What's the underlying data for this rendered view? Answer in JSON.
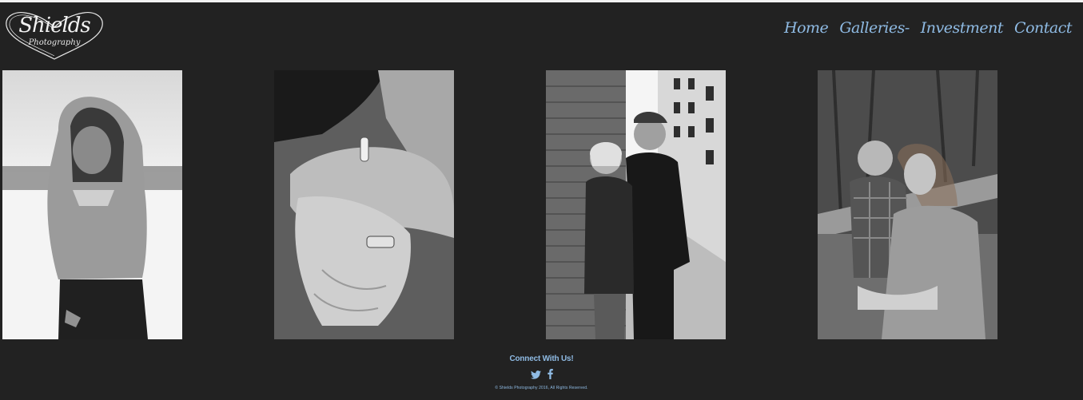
{
  "brand": {
    "name": "Shields",
    "tagline": "Photography"
  },
  "nav": {
    "items": [
      {
        "label": "Home"
      },
      {
        "label": "Galleries-"
      },
      {
        "label": "Investment"
      },
      {
        "label": "Contact"
      }
    ]
  },
  "gallery": {
    "photos": [
      {
        "subject": "woman-blowing-snow"
      },
      {
        "subject": "hands-with-rings"
      },
      {
        "subject": "couple-by-brick-wall"
      },
      {
        "subject": "mother-holding-child"
      }
    ]
  },
  "footer": {
    "connect_label": "Connect With Us!",
    "social_icons": [
      "twitter-icon",
      "facebook-icon"
    ],
    "copyright": "© Shields Photography 2016, All Rights Reserved."
  },
  "colors": {
    "background": "#222222",
    "accent": "#8fbbe4",
    "top_border": "#f2f2f2"
  }
}
